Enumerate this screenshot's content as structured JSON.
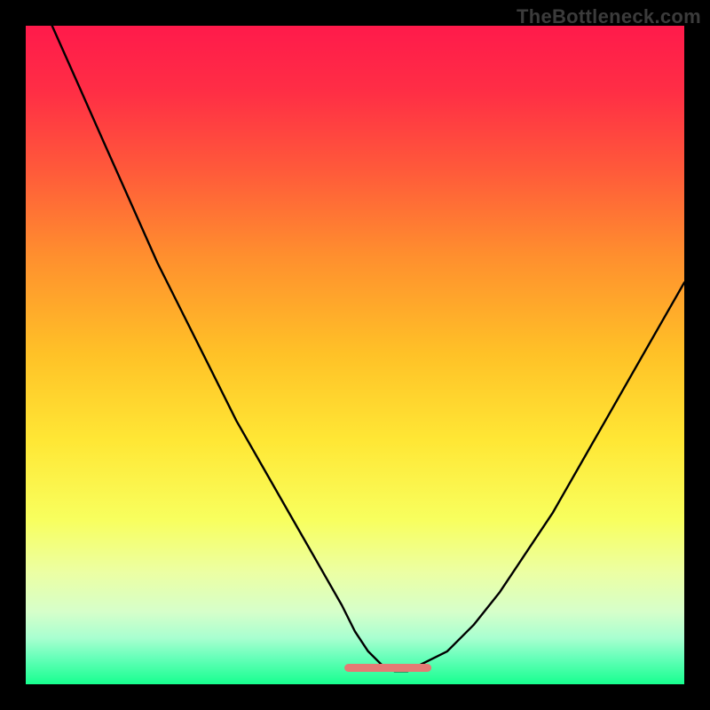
{
  "watermark": "TheBottleneck.com",
  "colors": {
    "frame": "#000000",
    "line": "#000000",
    "bottom_line": "#e47a74",
    "gradient_stops": [
      {
        "pct": 0,
        "color": "#ff1a4b"
      },
      {
        "pct": 10,
        "color": "#ff2e45"
      },
      {
        "pct": 22,
        "color": "#ff5a3a"
      },
      {
        "pct": 35,
        "color": "#ff8f2e"
      },
      {
        "pct": 50,
        "color": "#ffc227"
      },
      {
        "pct": 63,
        "color": "#ffe735"
      },
      {
        "pct": 75,
        "color": "#f8ff5e"
      },
      {
        "pct": 83,
        "color": "#ecffa3"
      },
      {
        "pct": 89,
        "color": "#d6ffca"
      },
      {
        "pct": 93,
        "color": "#a8ffd0"
      },
      {
        "pct": 96,
        "color": "#66ffb9"
      },
      {
        "pct": 100,
        "color": "#17ff8f"
      }
    ]
  },
  "chart_data": {
    "type": "line",
    "title": "",
    "xlabel": "",
    "ylabel": "",
    "xlim": [
      0,
      100
    ],
    "ylim": [
      0,
      100
    ],
    "grid": false,
    "series": [
      {
        "name": "bottleneck-curve",
        "x": [
          4,
          8,
          12,
          16,
          20,
          24,
          28,
          32,
          36,
          40,
          44,
          48,
          50,
          52,
          54,
          56,
          58,
          60,
          64,
          68,
          72,
          76,
          80,
          84,
          88,
          92,
          96,
          100
        ],
        "values": [
          100,
          91,
          82,
          73,
          64,
          56,
          48,
          40,
          33,
          26,
          19,
          12,
          8,
          5,
          3,
          2,
          2,
          3,
          5,
          9,
          14,
          20,
          26,
          33,
          40,
          47,
          54,
          61
        ]
      }
    ],
    "annotations": [
      {
        "name": "optimal-range",
        "type": "segment",
        "x": [
          49,
          61
        ],
        "y": [
          2.5,
          2.5
        ]
      }
    ]
  }
}
